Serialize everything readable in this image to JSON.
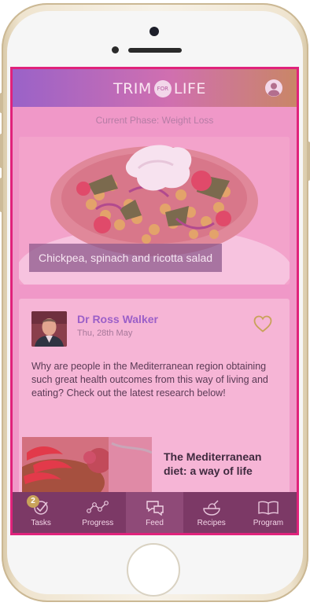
{
  "header": {
    "logo_left": "TRIM",
    "logo_mid": "FOR",
    "logo_right": "LIFE"
  },
  "phase_text": "Current Phase: Weight Loss",
  "recipe_card": {
    "caption": "Chickpea, spinach and ricotta salad"
  },
  "post": {
    "author": "Dr Ross Walker",
    "date": "Thu, 28th May",
    "text": "Why are people in the Mediterranean region obtaining such great health outcomes from this way of living and eating?  Check out the latest research below!",
    "article_title": "The Mediterranean diet: a way of life"
  },
  "tabs": [
    {
      "label": "Tasks",
      "icon": "tasks-icon",
      "badge": "2"
    },
    {
      "label": "Progress",
      "icon": "progress-icon"
    },
    {
      "label": "Feed",
      "icon": "feed-icon"
    },
    {
      "label": "Recipes",
      "icon": "recipes-icon"
    },
    {
      "label": "Program",
      "icon": "program-icon"
    }
  ],
  "colors": {
    "overlay_pink": "#f098c8",
    "screen_border": "#e0227b",
    "tabbar": "#7c3966",
    "author_purple": "#9b5fc8",
    "gold_accent": "#c9a25a"
  }
}
